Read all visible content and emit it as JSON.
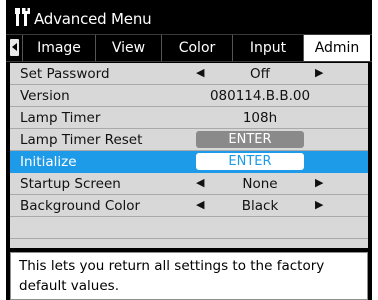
{
  "title": {
    "text": "Advanced Menu",
    "icon": "tools-icon"
  },
  "tabs": [
    {
      "label": "Image"
    },
    {
      "label": "View"
    },
    {
      "label": "Color"
    },
    {
      "label": "Input"
    },
    {
      "label": "Admin"
    }
  ],
  "menu": [
    {
      "name": "Set Password",
      "value": "Off"
    },
    {
      "name": "Version",
      "value": "080114.B.B.00"
    },
    {
      "name": "Lamp Timer",
      "value": "108h"
    },
    {
      "name": "Lamp Timer Reset",
      "value": "ENTER"
    },
    {
      "name": "Initialize",
      "value": "ENTER"
    },
    {
      "name": "Startup Screen",
      "value": "None"
    },
    {
      "name": "Background Color",
      "value": "Black"
    }
  ],
  "help": {
    "text": "This lets you return all settings to the factory default values."
  },
  "colors": {
    "highlight": "#1e9be8",
    "background": "#000000",
    "row": "#d8d8d8"
  }
}
